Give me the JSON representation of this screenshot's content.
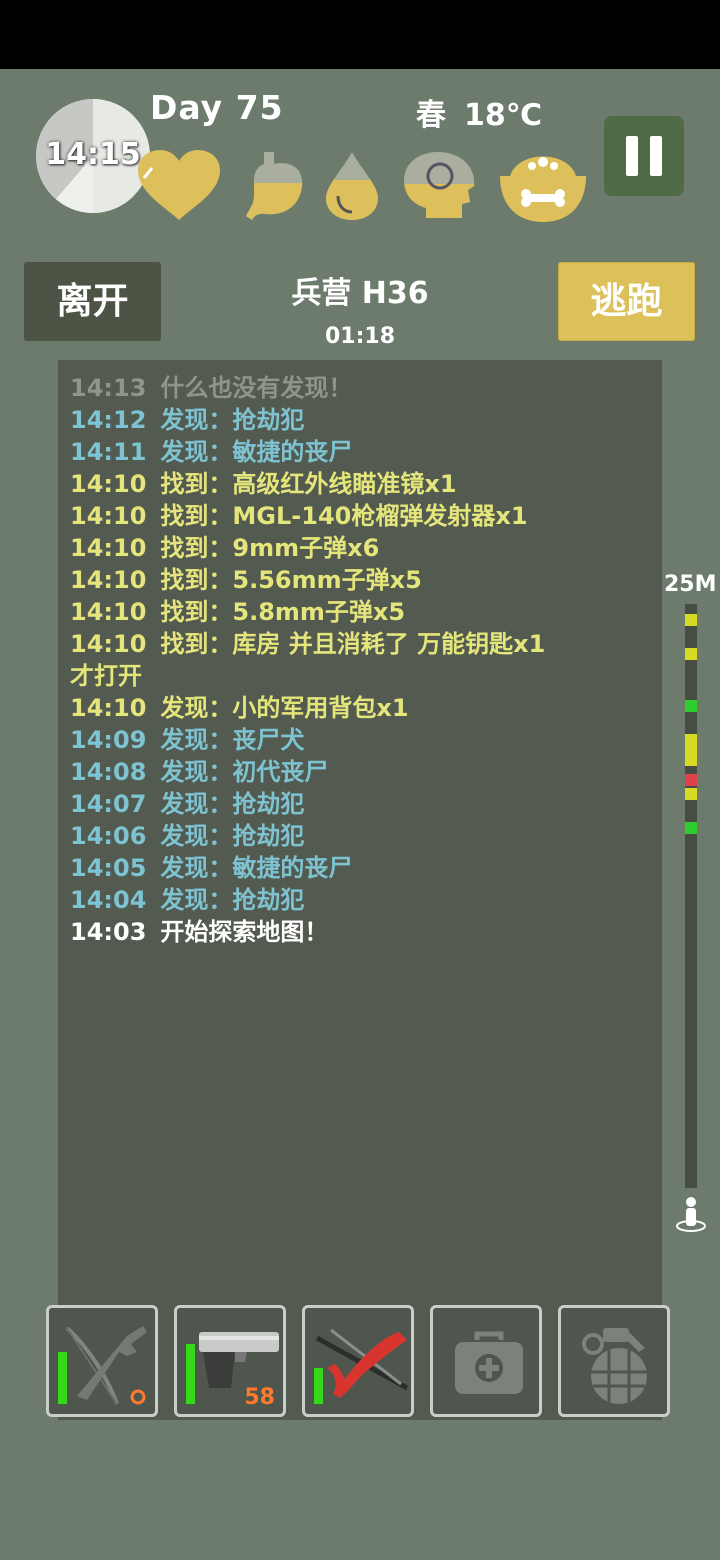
{
  "hud": {
    "clock_time": "14:15",
    "day_text": "Day 75",
    "season": "春",
    "temperature": "18℃",
    "stats": [
      {
        "name": "health",
        "icon": "heart-icon",
        "level": 1.0
      },
      {
        "name": "hunger",
        "icon": "stomach-icon",
        "level": 0.45
      },
      {
        "name": "thirst",
        "icon": "water-drop-icon",
        "level": 0.6
      },
      {
        "name": "mental",
        "icon": "head-icon",
        "level": 0.45
      },
      {
        "name": "pet_food",
        "icon": "pet-bowl-icon",
        "level": 1.0
      }
    ],
    "pause_icon": "pause-icon"
  },
  "header": {
    "leave_label": "离开",
    "flee_label": "逃跑",
    "location": "兵营 H36",
    "timer": "01:18"
  },
  "log": [
    {
      "time": "14:13",
      "text": "什么也没有发现！",
      "color": "grey"
    },
    {
      "time": "14:12",
      "text": "发现：抢劫犯",
      "color": "blue"
    },
    {
      "time": "14:11",
      "text": "发现：敏捷的丧尸",
      "color": "blue"
    },
    {
      "time": "14:10",
      "text": "找到：高级红外线瞄准镜x1",
      "color": "yellow"
    },
    {
      "time": "14:10",
      "text": "找到：MGL-140枪榴弹发射器x1",
      "color": "yellow"
    },
    {
      "time": "14:10",
      "text": "找到：9mm子弹x6",
      "color": "yellow"
    },
    {
      "time": "14:10",
      "text": "找到：5.56mm子弹x5",
      "color": "yellow"
    },
    {
      "time": "14:10",
      "text": "找到：5.8mm子弹x5",
      "color": "yellow"
    },
    {
      "time": "14:10",
      "text": "找到：库房 并且消耗了 万能钥匙x1",
      "color": "yellow"
    },
    {
      "time": "",
      "text": "才打开",
      "color": "yellow"
    },
    {
      "time": "14:10",
      "text": "发现：小的军用背包x1",
      "color": "yellow"
    },
    {
      "time": "14:09",
      "text": "发现：丧尸犬",
      "color": "blue"
    },
    {
      "time": "14:08",
      "text": "发现：初代丧尸",
      "color": "blue"
    },
    {
      "time": "14:07",
      "text": "发现：抢劫犯",
      "color": "blue"
    },
    {
      "time": "14:06",
      "text": "发现：抢劫犯",
      "color": "blue"
    },
    {
      "time": "14:05",
      "text": "发现：敏捷的丧尸",
      "color": "blue"
    },
    {
      "time": "14:04",
      "text": "发现：抢劫犯",
      "color": "blue"
    },
    {
      "time": "14:03",
      "text": "开始探索地图！",
      "color": "white"
    }
  ],
  "depth": {
    "label": "25M",
    "player_icon": "player-marker-icon"
  },
  "slots": [
    {
      "icon": "rifle-crossbow-icon",
      "durability": 0.55,
      "count": "0"
    },
    {
      "icon": "pistol-icon",
      "durability": 0.65,
      "count": "58"
    },
    {
      "icon": "melee-weapons-icon",
      "durability": 0.38,
      "count": ""
    },
    {
      "icon": "medkit-icon",
      "durability": 0,
      "count": ""
    },
    {
      "icon": "grenade-icon",
      "durability": 0,
      "count": ""
    }
  ],
  "colors": {
    "background": "#6c7b6b",
    "panel": "#535a50",
    "yellow_accent": "#dcc05a",
    "log_blue": "#7ec3d1",
    "log_yellow": "#e4e57b",
    "log_grey": "#8e958c",
    "durability_green": "#35d91a"
  }
}
